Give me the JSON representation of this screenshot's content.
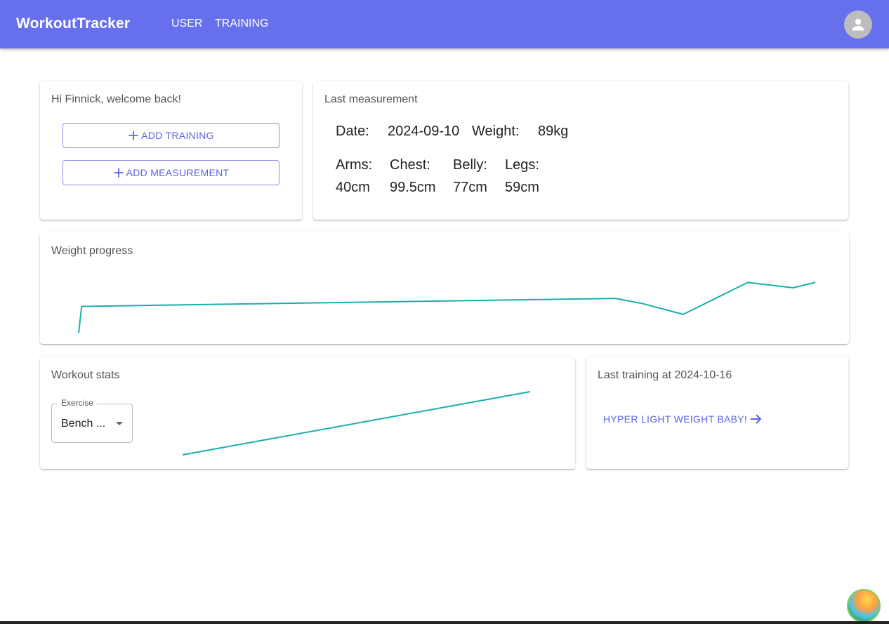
{
  "header": {
    "brand": "WorkoutTracker",
    "nav": {
      "user": "USER",
      "training": "TRAINING"
    },
    "accent_color": "#6770ec",
    "avatar_icon": "account-circle-icon"
  },
  "welcome": {
    "greeting": "Hi Finnick, welcome back!",
    "add_training": "ADD TRAINING",
    "add_measurement": "ADD MEASUREMENT",
    "plus_icon": "+"
  },
  "last_measurement": {
    "title": "Last measurement",
    "date_label": "Date:",
    "date_value": "2024-09-10",
    "weight_label": "Weight:",
    "weight_value": "89kg",
    "arms_label": "Arms:",
    "arms_value": "40cm",
    "chest_label": "Chest:",
    "chest_value": "99.5cm",
    "belly_label": "Belly:",
    "belly_value": "77cm",
    "legs_label": "Legs:",
    "legs_value": "59cm"
  },
  "weight_progress": {
    "title": "Weight progress"
  },
  "workout_stats": {
    "title": "Workout stats",
    "exercise_label": "Exercise",
    "exercise_value": "Bench ..."
  },
  "last_training": {
    "title": "Last training at 2024-10-16",
    "link_label": "HYPER LIGHT WEIGHT BABY!",
    "link_icon": "arrow-right-icon"
  },
  "chart_data": [
    {
      "type": "line",
      "title": "Weight progress",
      "series_color": "#1aafaa",
      "x": [
        0,
        0.3,
        53.3,
        56,
        60,
        66.4,
        70.9,
        73.1
      ],
      "y": [
        80,
        85,
        86.5,
        85.5,
        83.5,
        89.5,
        88.5,
        89.5
      ],
      "ylim": [
        79,
        91
      ]
    },
    {
      "type": "line",
      "title": "Workout stats",
      "series_color": "#1aafaa",
      "x": [
        0,
        1
      ],
      "y": [
        0,
        1
      ],
      "ylim": [
        0,
        1
      ]
    }
  ]
}
